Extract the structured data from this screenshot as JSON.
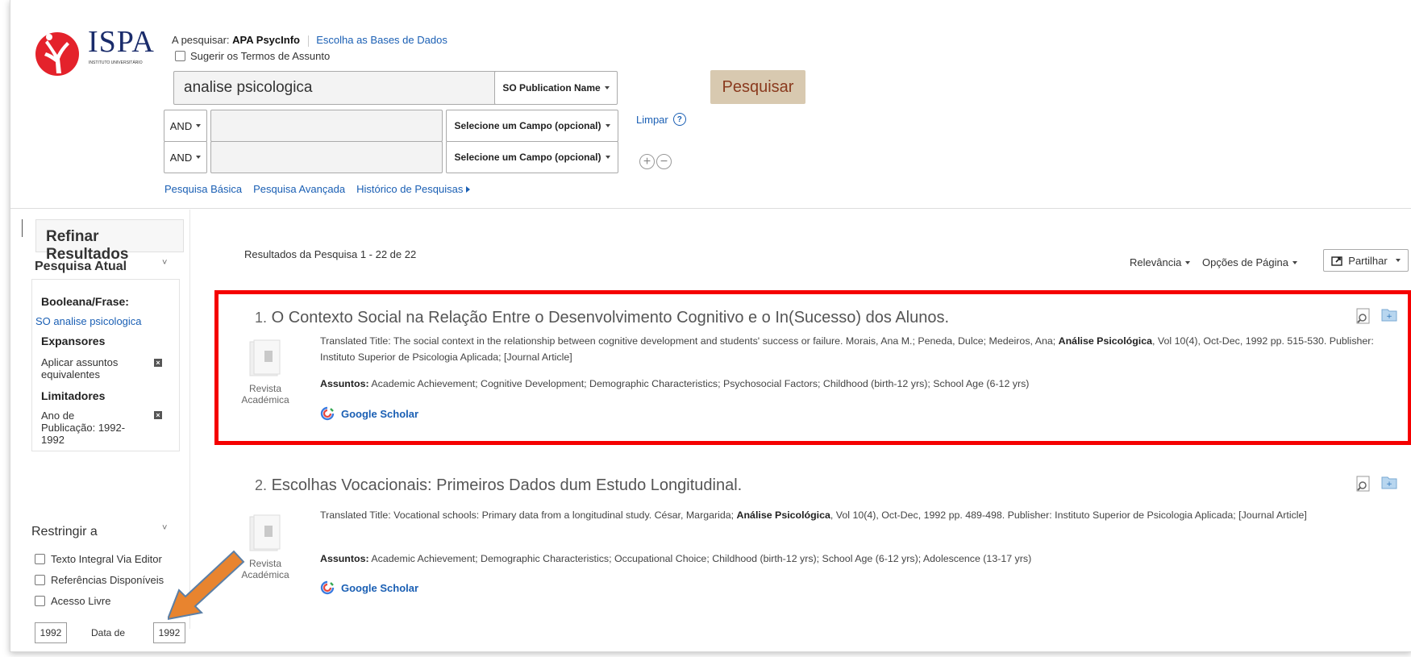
{
  "brand": {
    "logo_text": "ISPA",
    "logo_sub": "INSTITUTO UNIVERSITÁRIO"
  },
  "search": {
    "searching_label": "A pesquisar:",
    "database": "APA PsycInfo",
    "choose_db": "Escolha as Bases de Dados",
    "suggest_terms": "Sugerir os Termos de Assunto",
    "query": "analise psicologica",
    "query_field": "SO Publication Name",
    "search_button": "Pesquisar",
    "rows": [
      {
        "operator": "AND",
        "value": "",
        "field": "Selecione um Campo (opcional)"
      },
      {
        "operator": "AND",
        "value": "",
        "field": "Selecione um Campo (opcional)"
      }
    ],
    "clear": "Limpar",
    "help": "?",
    "links": {
      "basic": "Pesquisa Básica",
      "advanced": "Pesquisa Avançada",
      "history": "Histórico de Pesquisas"
    }
  },
  "sidebar": {
    "title": "Refinar Resultados",
    "current_search": "Pesquisa Atual",
    "boolean_label": "Booleana/Frase:",
    "boolean_value": "SO analise psicologica",
    "expanders_label": "Expansores",
    "expander_item": "Aplicar assuntos equivalentes",
    "limiters_label": "Limitadores",
    "limiter_item": "Ano de Publicação: 1992-1992",
    "restrict_label": "Restringir a",
    "checkboxes": [
      "Texto Integral Via Editor",
      "Referências Disponíveis",
      "Acesso Livre"
    ],
    "year_from": "1992",
    "date_label": "Data de",
    "year_to": "1992"
  },
  "results": {
    "count_text": "Resultados da Pesquisa 1 - 22 de 22",
    "sort": "Relevância",
    "page_options": "Opções de Página",
    "share": "Partilhar",
    "items": [
      {
        "num": "1.",
        "title": "O Contexto Social na Relação Entre o Desenvolvimento Cognitivo e o In(Sucesso) dos Alunos.",
        "desc_pre": "Translated Title: The social context in the relationship between cognitive development and students' success or failure. Morais, Ana M.; Peneda, Dulce; Medeiros, Ana;",
        "journal": "Análise Psicológica",
        "desc_post": ", Vol 10(4), Oct-Dec, 1992 pp. 515-530. Publisher: Instituto Superior de Psicologia Aplicada; [Journal Article]",
        "subjects_label": "Assuntos:",
        "subjects": "Academic Achievement; Cognitive Development; Demographic Characteristics; Psychosocial Factors; Childhood (birth-12 yrs); School Age (6-12 yrs)",
        "type_label": "Revista Académica",
        "scholar": "Google Scholar"
      },
      {
        "num": "2.",
        "title": "Escolhas Vocacionais: Primeiros Dados dum Estudo Longitudinal.",
        "desc_pre": "Translated Title: Vocational schools: Primary data from a longitudinal study. César, Margarida;",
        "journal": "Análise Psicológica",
        "desc_post": ", Vol 10(4), Oct-Dec, 1992 pp. 489-498. Publisher: Instituto Superior de Psicologia Aplicada; [Journal Article]",
        "subjects_label": "Assuntos:",
        "subjects": "Academic Achievement; Demographic Characteristics; Occupational Choice; Childhood (birth-12 yrs); School Age (6-12 yrs); Adolescence (13-17 yrs)",
        "type_label": "Revista Académica",
        "scholar": "Google Scholar"
      }
    ]
  },
  "colors": {
    "highlight_box": "#f50000",
    "arrow": "#e8842f",
    "link": "#1a5fb4",
    "search_btn": "#d8c9b0"
  }
}
